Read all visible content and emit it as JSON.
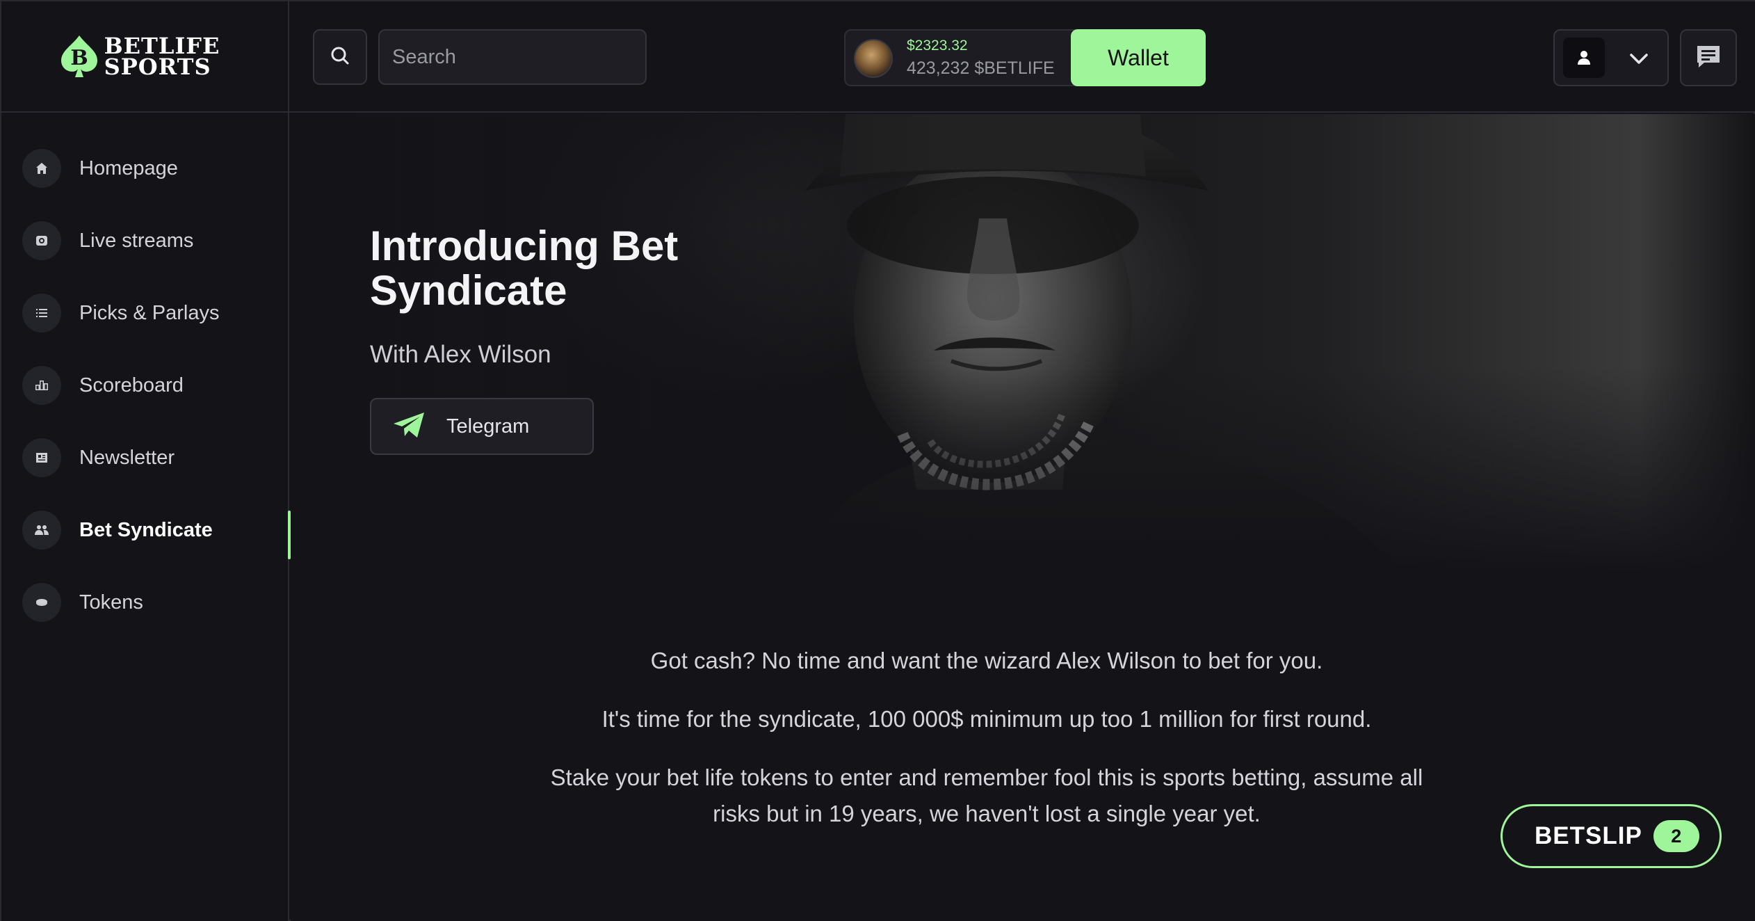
{
  "brand": {
    "line1": "BETLIFE",
    "line2": "SPORTS",
    "accent": "#9ff59a"
  },
  "sidebar": {
    "items": [
      {
        "label": "Homepage",
        "icon": "home-icon",
        "active": false
      },
      {
        "label": "Live streams",
        "icon": "camera-icon",
        "active": false
      },
      {
        "label": "Picks & Parlays",
        "icon": "list-icon",
        "active": false
      },
      {
        "label": "Scoreboard",
        "icon": "podium-icon",
        "active": false
      },
      {
        "label": "Newsletter",
        "icon": "newspaper-icon",
        "active": false
      },
      {
        "label": "Bet Syndicate",
        "icon": "group-icon",
        "active": true
      },
      {
        "label": "Tokens",
        "icon": "coin-icon",
        "active": false
      }
    ]
  },
  "topbar": {
    "search_placeholder": "Search",
    "balance_usd": "$2323.32",
    "balance_tokens": "423,232 $BETLIFE",
    "wallet_label": "Wallet"
  },
  "hero": {
    "title": "Introducing Bet Syndicate",
    "subtitle": "With Alex Wilson",
    "telegram_label": "Telegram"
  },
  "body": {
    "p1": "Got cash? No time and want the wizard Alex Wilson to bet for you.",
    "p2": "It's time for the syndicate, 100 000$ minimum up too 1 million for first round.",
    "p3": "Stake your bet life tokens to enter and remember fool this is sports betting, assume all risks but in 19 years, we haven't lost a single year yet."
  },
  "betslip": {
    "label": "BETSLIP",
    "count": "2"
  }
}
